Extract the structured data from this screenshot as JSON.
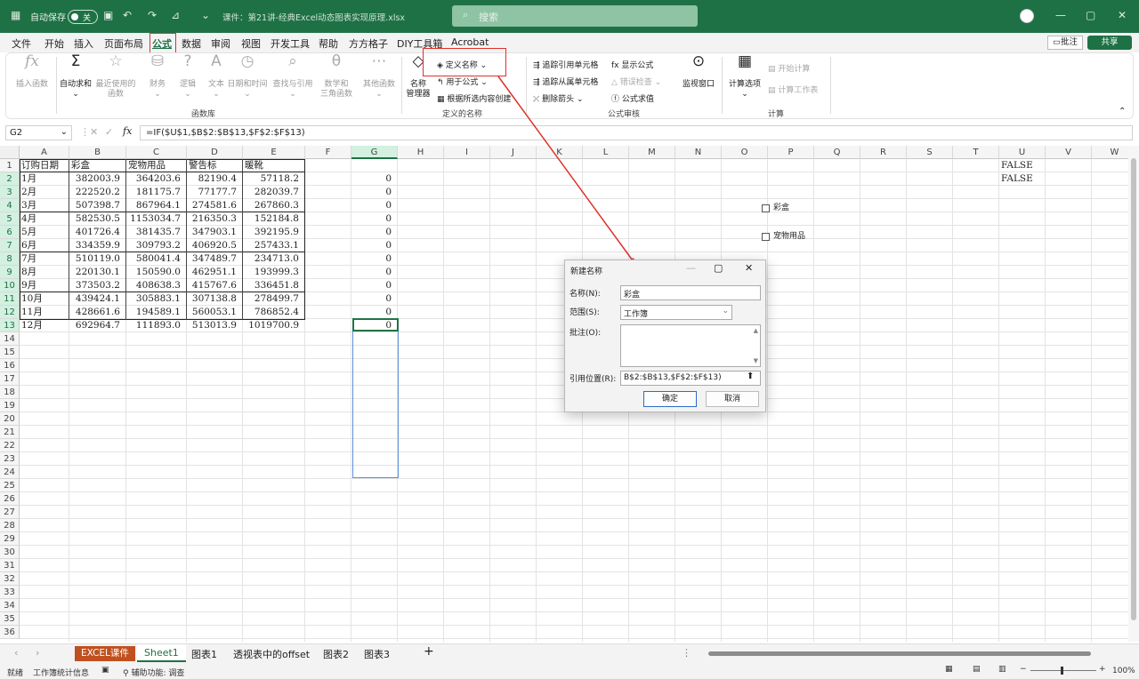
{
  "titlebar": {
    "autosave": "自动保存",
    "toggle": "关",
    "filename": "课件：第21讲-经典Excel动态图表实现原理.xlsx",
    "search": "搜索"
  },
  "menu": {
    "items": [
      "文件",
      "开始",
      "插入",
      "页面布局",
      "公式",
      "数据",
      "审阅",
      "视图",
      "开发工具",
      "帮助",
      "方方格子",
      "DIY工具箱",
      "Acrobat"
    ],
    "comment": "批注",
    "share": "共享"
  },
  "ribbon": {
    "lib": [
      "插入函数",
      "自动求和",
      "最近使用的\n函数",
      "财务",
      "逻辑",
      "文本",
      "日期和时间",
      "查找与引用",
      "数学和\n三角函数",
      "其他函数"
    ],
    "lib_group": "函数库",
    "name_mgr": "名称\n管理器",
    "define_name": "定义名称",
    "use_formula": "用于公式",
    "create_sel": "根据所选内容创建",
    "names_group": "定义的名称",
    "audit": [
      "追踪引用单元格",
      "追踪从属单元格",
      "删除箭头",
      "显示公式",
      "错误检查",
      "公式求值"
    ],
    "audit_group": "公式审核",
    "watch": "监视窗口",
    "calc_opt": "计算选项",
    "calc_now": "开始计算",
    "calc_sheet": "计算工作表",
    "calc_group": "计算"
  },
  "formula_bar": {
    "name": "G2",
    "formula": "=IF($U$1,$B$2:$B$13,$F$2:$F$13)",
    "fx": "fx"
  },
  "columns": [
    "A",
    "B",
    "C",
    "D",
    "E",
    "F",
    "G",
    "H",
    "I",
    "J",
    "K",
    "L",
    "M",
    "N",
    "O",
    "P",
    "Q",
    "R",
    "S",
    "T",
    "U",
    "V",
    "W"
  ],
  "headers": [
    "订购日期",
    "彩盒",
    "宠物用品",
    "警告标",
    "暖靴"
  ],
  "rows": [
    [
      "1月",
      "382003.9",
      "364203.6",
      "82190.4",
      "57118.2"
    ],
    [
      "2月",
      "222520.2",
      "181175.7",
      "77177.7",
      "282039.7"
    ],
    [
      "3月",
      "507398.7",
      "867964.1",
      "274581.6",
      "267860.3"
    ],
    [
      "4月",
      "582530.5",
      "1153034.7",
      "216350.3",
      "152184.8"
    ],
    [
      "5月",
      "401726.4",
      "381435.7",
      "347903.1",
      "392195.9"
    ],
    [
      "6月",
      "334359.9",
      "309793.2",
      "406920.5",
      "257433.1"
    ],
    [
      "7月",
      "510119.0",
      "580041.4",
      "347489.7",
      "234713.0"
    ],
    [
      "8月",
      "220130.1",
      "150590.0",
      "462951.1",
      "193999.3"
    ],
    [
      "9月",
      "373503.2",
      "408638.3",
      "415767.6",
      "336451.8"
    ],
    [
      "10月",
      "439424.1",
      "305883.1",
      "307138.8",
      "278499.7"
    ],
    [
      "11月",
      "428661.6",
      "194589.1",
      "560053.1",
      "786852.4"
    ],
    [
      "12月",
      "692964.7",
      "111893.0",
      "513013.9",
      "1019700.9"
    ]
  ],
  "g_values": [
    "0",
    "0",
    "0",
    "0",
    "0",
    "0",
    "0",
    "0",
    "0",
    "0",
    "0",
    "0"
  ],
  "u_values": [
    "FALSE",
    "FALSE"
  ],
  "checkboxes": [
    "彩盒",
    "宠物用品"
  ],
  "dialog": {
    "title": "新建名称",
    "name_label": "名称(N):",
    "name_value": "彩盒",
    "scope_label": "范围(S):",
    "scope_value": "工作簿",
    "comment_label": "批注(O):",
    "ref_label": "引用位置(R):",
    "ref_value": "B$2:$B$13,$F$2:$F$13)",
    "ok": "确定",
    "cancel": "取消"
  },
  "sheets": {
    "tabs": [
      "EXCEL课件",
      "Sheet1",
      "图表1",
      "透视表中的offset",
      "图表2",
      "图表3"
    ],
    "active": "Sheet1",
    "add": "+"
  },
  "status": {
    "ready": "就绪",
    "stats": "工作簿统计信息",
    "access": "辅助功能: 调查",
    "zoom": "100%"
  }
}
